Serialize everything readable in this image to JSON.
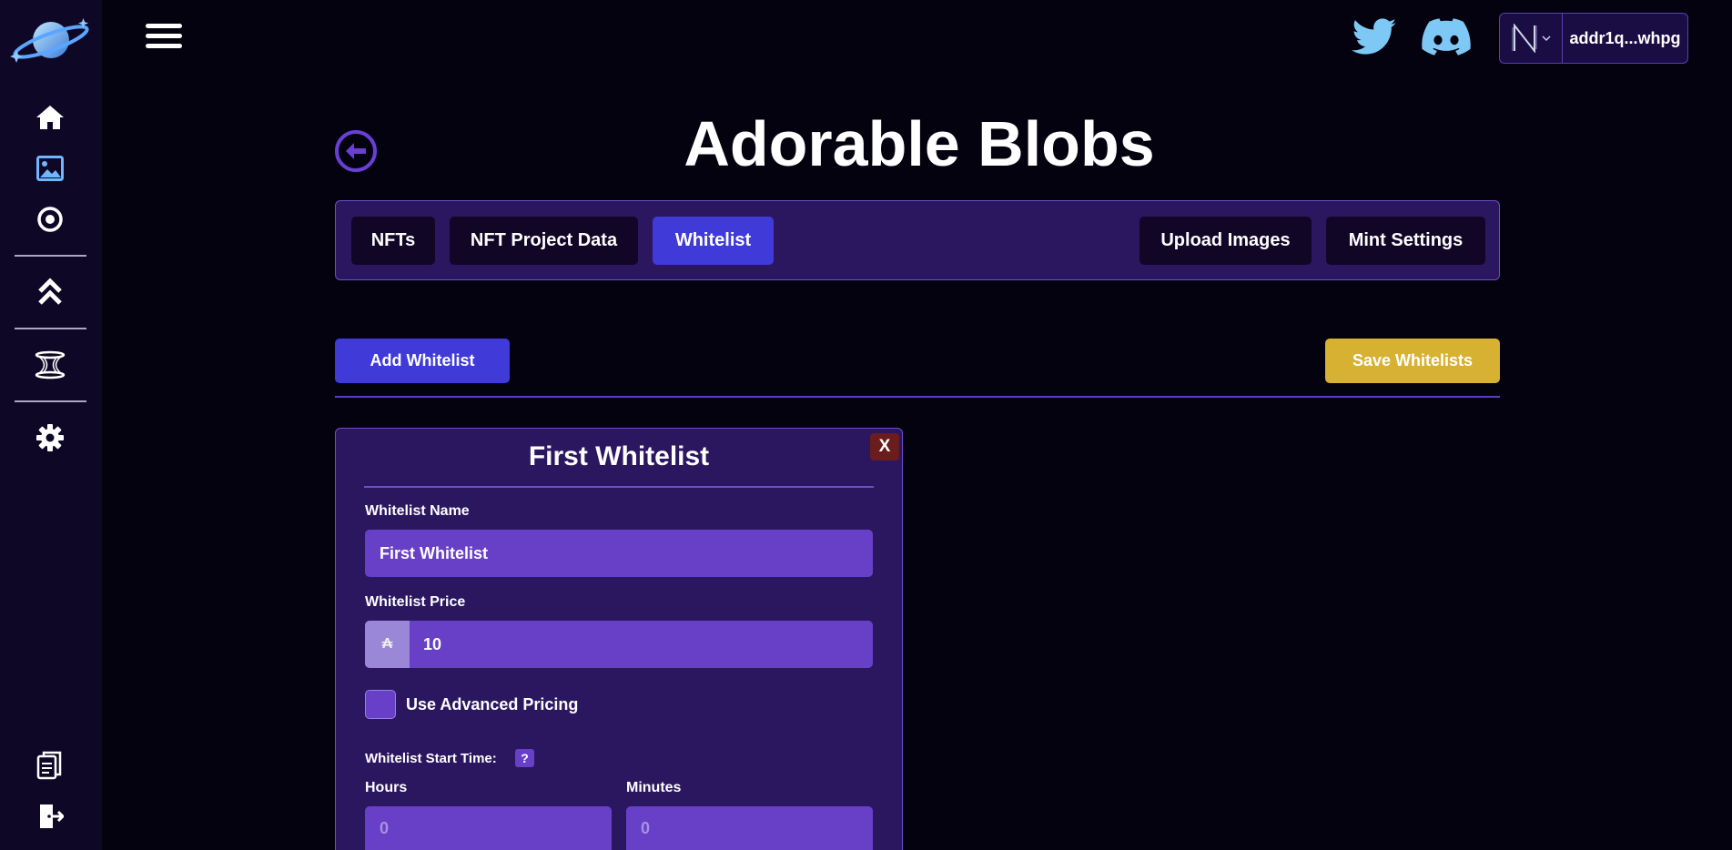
{
  "header": {
    "wallet_address": "addr1q...whpg"
  },
  "page": {
    "title": "Adorable Blobs"
  },
  "tabs": [
    {
      "label": "NFTs"
    },
    {
      "label": "NFT Project Data"
    },
    {
      "label": "Whitelist",
      "active": true
    },
    {
      "label": "Upload Images"
    },
    {
      "label": "Mint Settings"
    }
  ],
  "actions": {
    "add_label": "Add Whitelist",
    "save_label": "Save Whitelists"
  },
  "whitelist_card": {
    "close_label": "X",
    "title": "First Whitelist",
    "name_label": "Whitelist Name",
    "name_value": "First Whitelist",
    "price_label": "Whitelist Price",
    "price_currency": "₳",
    "price_value": "10",
    "advanced_pricing_label": "Use Advanced Pricing",
    "start_time_label": "Whitelist Start Time:",
    "help_label": "?",
    "hours_label": "Hours",
    "hours_value": "0",
    "minutes_label": "Minutes",
    "minutes_value": "0"
  },
  "colors": {
    "background": "#04020f",
    "sidebar": "#0f0726",
    "accent": "#3f3ad8",
    "panel": "#2b1660",
    "input": "#6840c8",
    "save": "#d6b132",
    "close": "#6b1c1c"
  },
  "icons": {
    "sidebar": [
      "home-icon",
      "image-icon",
      "target-icon",
      "chevrons-up-icon",
      "hourglass-icon",
      "gear-icon",
      "documents-icon",
      "logout-icon"
    ],
    "header": [
      "menu-icon",
      "twitter-icon",
      "discord-icon",
      "wallet-icon"
    ]
  }
}
